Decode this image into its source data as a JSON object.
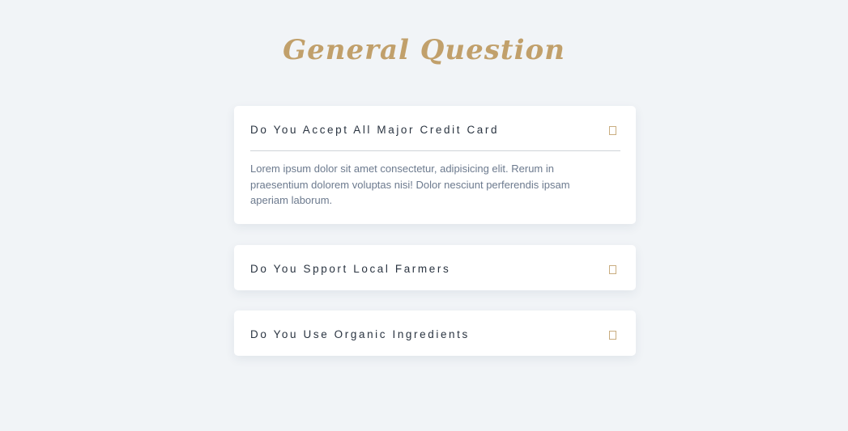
{
  "section": {
    "title": "General Question"
  },
  "faqs": [
    {
      "question": "Do You Accept All Major Credit Card",
      "answer": "Lorem ipsum dolor sit amet consectetur, adipisicing elit. Rerum in praesentium dolorem voluptas nisi! Dolor nesciunt perferendis ipsam aperiam laborum.",
      "expanded": true,
      "icon": "toggle-icon"
    },
    {
      "question": "Do You Spport Local Farmers",
      "expanded": false,
      "icon": "toggle-icon"
    },
    {
      "question": "Do You Use Organic Ingredients",
      "expanded": false,
      "icon": "toggle-icon"
    }
  ],
  "colors": {
    "background": "#f1f4f7",
    "accent": "#c1a06b",
    "question_text": "#2a3441",
    "answer_text": "#6c7a8e",
    "card": "#ffffff"
  }
}
